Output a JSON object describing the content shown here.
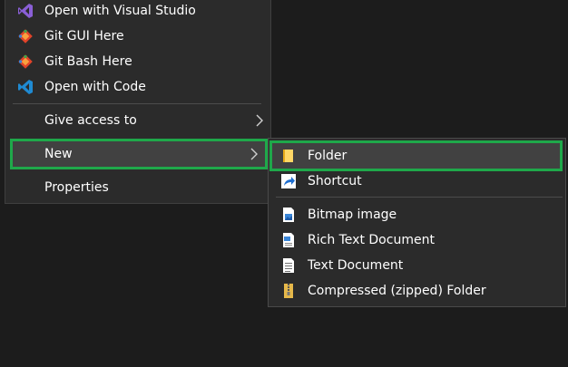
{
  "context_menu": {
    "items": [
      {
        "label": "Open with Visual Studio",
        "icon": "visual-studio-icon"
      },
      {
        "label": "Git GUI Here",
        "icon": "git-icon"
      },
      {
        "label": "Git Bash Here",
        "icon": "git-icon"
      },
      {
        "label": "Open with Code",
        "icon": "vscode-icon"
      },
      {
        "label": "Give access to",
        "icon": "",
        "has_submenu": true
      },
      {
        "label": "New",
        "icon": "",
        "has_submenu": true,
        "highlighted": true
      },
      {
        "label": "Properties",
        "icon": ""
      }
    ]
  },
  "new_submenu": {
    "items": [
      {
        "label": "Folder",
        "icon": "folder-icon",
        "highlighted": true
      },
      {
        "label": "Shortcut",
        "icon": "shortcut-icon"
      },
      {
        "label": "Bitmap image",
        "icon": "bitmap-image-icon"
      },
      {
        "label": "Rich Text Document",
        "icon": "rich-text-document-icon"
      },
      {
        "label": "Text Document",
        "icon": "text-document-icon"
      },
      {
        "label": "Compressed (zipped) Folder",
        "icon": "zip-folder-icon"
      }
    ]
  },
  "colors": {
    "menu_bg": "#2b2b2b",
    "desktop_bg": "#1c1c1c",
    "highlight_outline": "#1fa84a",
    "highlight_bg": "#414141"
  }
}
